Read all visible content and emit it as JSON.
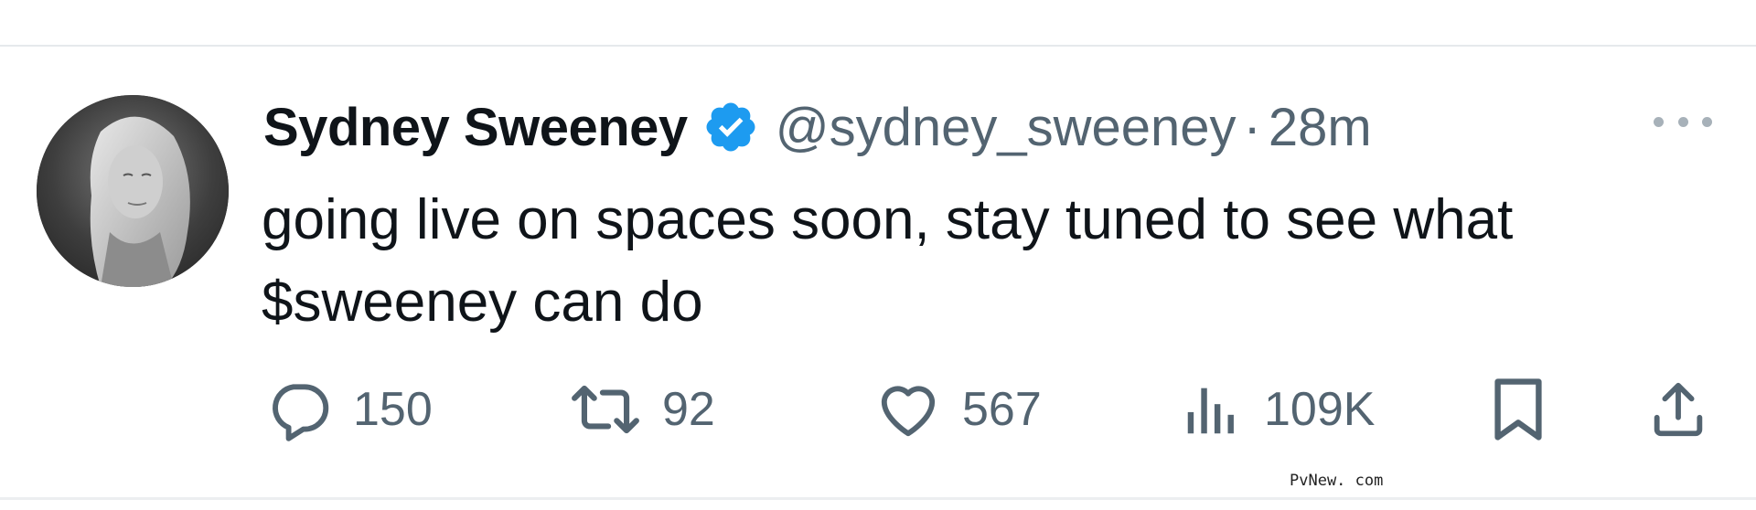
{
  "tweet": {
    "author": {
      "display_name": "Sydney Sweeney",
      "handle": "@sydney_sweeney",
      "verified": true,
      "avatar_icon": "profile-photo"
    },
    "separator": "·",
    "time": "28m",
    "text": "going live on spaces soon, stay tuned to see what $sweeney can do",
    "actions": {
      "replies": "150",
      "reposts": "92",
      "likes": "567",
      "views": "109K"
    },
    "icons": [
      "comment-icon",
      "repost-icon",
      "heart-icon",
      "views-icon",
      "bookmark-icon",
      "share-icon",
      "more-icon",
      "verified-badge-icon"
    ]
  },
  "colors": {
    "text_primary": "#0f1419",
    "text_secondary": "#536471",
    "verified_blue": "#1d9bf0"
  },
  "watermark": "PvNew. com"
}
